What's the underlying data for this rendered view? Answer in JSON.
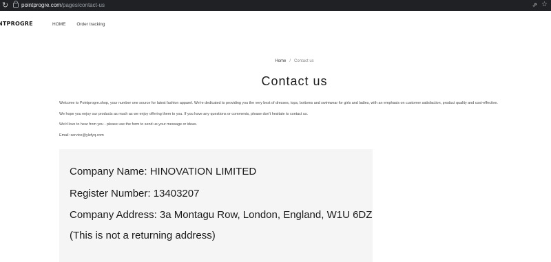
{
  "browser": {
    "url_host": "pointprogre.com",
    "url_path": "/pages/contact-us"
  },
  "header": {
    "logo_text": "NTPROGRE",
    "nav": [
      {
        "label": "HOME"
      },
      {
        "label": "Order tracking"
      }
    ]
  },
  "breadcrumb": {
    "home": "Home",
    "separator": "/",
    "current": "Contact us"
  },
  "page": {
    "title": "Contact us",
    "paragraphs": [
      "Welcome to Pointprogre.shop, your number one source for latest fashion apparel. We're dedicated to providing you the very best of dresses, tops, bottoms and swimwear for girls and ladies, with an emphasis on customer satisfaction, product quality and cost-effective.",
      "We hope you enjoy our products as much as we enjoy offering them to you. If you have any questions or comments, please don't hesitate to contact us.",
      "We'd love to hear from you - please use the form to send us your message or ideas.",
      "Email: service@ylefyq.com"
    ]
  },
  "company": {
    "name_line": "Company Name: HINOVATION LIMITED",
    "register_line": "Register Number: 13403207",
    "address_line": "Company Address: 3a Montagu Row, London, England, W1U 6DZ",
    "note_line": "(This is not a returning address)"
  }
}
